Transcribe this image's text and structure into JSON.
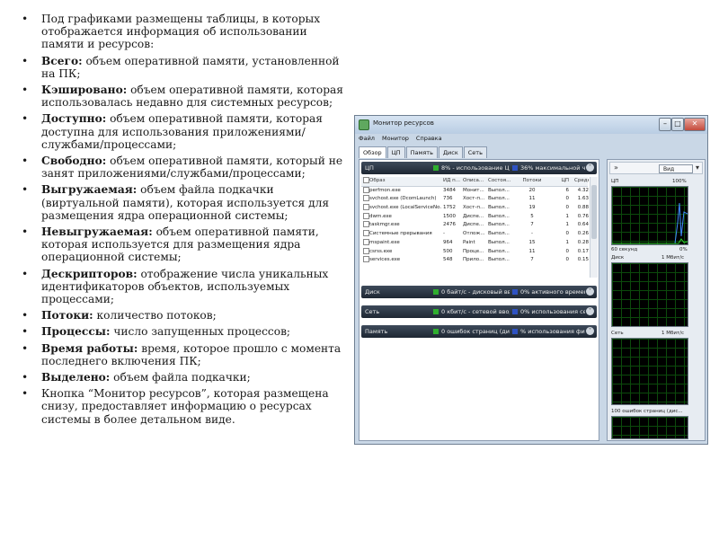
{
  "bullets": [
    {
      "term": "",
      "text": "Под графиками размещены таблицы, в которых отображается информация об использовании памяти и ресурсов:"
    },
    {
      "term": "Всего:",
      "text": " объем оперативной памяти, установленной на ПК;"
    },
    {
      "term": "Кэшировано:",
      "text": " объем оперативной памяти, которая использовалась недавно для системных ресурсов;"
    },
    {
      "term": "Доступно:",
      "text": " объем оперативной памяти, которая доступна для использования приложениями/службами/процессами;"
    },
    {
      "term": "Свободно:",
      "text": " объем оперативной памяти, который не занят приложениями/службами/процессами;"
    },
    {
      "term": "Выгружаемая:",
      "text": " объем файла подкачки (виртуальной памяти), которая используется для размещения ядра операционной системы;"
    },
    {
      "term": "Невыгружаемая:",
      "text": " объем оперативной памяти, которая используется для размещения ядра операционной системы;"
    },
    {
      "term": "Дескрипторов:",
      "text": " отображение числа уникальных идентификаторов объектов, используемых процессами;"
    },
    {
      "term": "Потоки:",
      "text": " количество потоков;"
    },
    {
      "term": "Процессы:",
      "text": " число запущенных процессов;"
    },
    {
      "term": "Время работы:",
      "text": " время, которое прошло с момента последнего включения ПК;"
    },
    {
      "term": "Выделено:",
      "text": " объем файла подкачки;"
    },
    {
      "term": "",
      "text": "Кнопка “Монитор ресурсов”, которая размещена снизу, предоставляет информацию о ресурсах системы в более детальном виде."
    }
  ],
  "window": {
    "title": "Монитор ресурсов",
    "menu": [
      "Файл",
      "Монитор",
      "Справка"
    ],
    "tabs": [
      "Обзор",
      "ЦП",
      "Память",
      "Диск",
      "Сеть"
    ],
    "sections": {
      "cpu": {
        "name": "ЦП",
        "info1": "8% - использование ЦП",
        "info2": "36% максимальной часто..."
      },
      "disk": {
        "name": "Диск",
        "info1": "0 байт/с - дисковый ввод-...",
        "info2": "0% активного времени (м..."
      },
      "net": {
        "name": "Сеть",
        "info1": "0 кбит/с - сетевой ввод-в...",
        "info2": "0% использования сети (%..."
      },
      "mem": {
        "name": "Память",
        "info1": "0 ошибок страниц (диск)/...",
        "info2": "% использования физическ..."
      }
    },
    "table": {
      "headers": [
        "Образ",
        "ИД п...",
        "Описа...",
        "Состоя...",
        "Потоки",
        "ЦП",
        "Средн..."
      ],
      "rows": [
        [
          "perfmon.exe",
          "3484",
          "Монит...",
          "Выпол...",
          "20",
          "6",
          "4.32"
        ],
        [
          "svchost.exe (DcomLaunch)",
          "736",
          "Хост-п...",
          "Выпол...",
          "11",
          "0",
          "1.63"
        ],
        [
          "svchost.exe (LocalServiceNo...",
          "1752",
          "Хост-п...",
          "Выпол...",
          "19",
          "0",
          "0.88"
        ],
        [
          "dwm.exe",
          "1500",
          "Диспе...",
          "Выпол...",
          "5",
          "1",
          "0.76"
        ],
        [
          "taskmgr.exe",
          "2476",
          "Диспе...",
          "Выпол...",
          "7",
          "1",
          "0.64"
        ],
        [
          "Системные прерывания",
          "-",
          "Отлож...",
          "Выпол...",
          "-",
          "0",
          "0.26"
        ],
        [
          "mspaint.exe",
          "964",
          "Paint",
          "Выпол...",
          "15",
          "1",
          "0.28"
        ],
        [
          "csrss.exe",
          "500",
          "Проце...",
          "Выпол...",
          "11",
          "0",
          "0.17"
        ],
        [
          "services.exe",
          "548",
          "Прило...",
          "Выпол...",
          "7",
          "0",
          "0.15"
        ]
      ]
    },
    "view_button": "Вид",
    "graphs": {
      "cpu_label": "ЦП",
      "cpu_max": "100%",
      "cpu_time": "60 секунд",
      "cpu_min": "0%",
      "disk_label": "Диск",
      "disk_max": "1 Мбит/с",
      "net_label": "Сеть",
      "net_max": "1 Мбит/с",
      "mem_label": "100 ошибок страниц (дис..."
    }
  }
}
